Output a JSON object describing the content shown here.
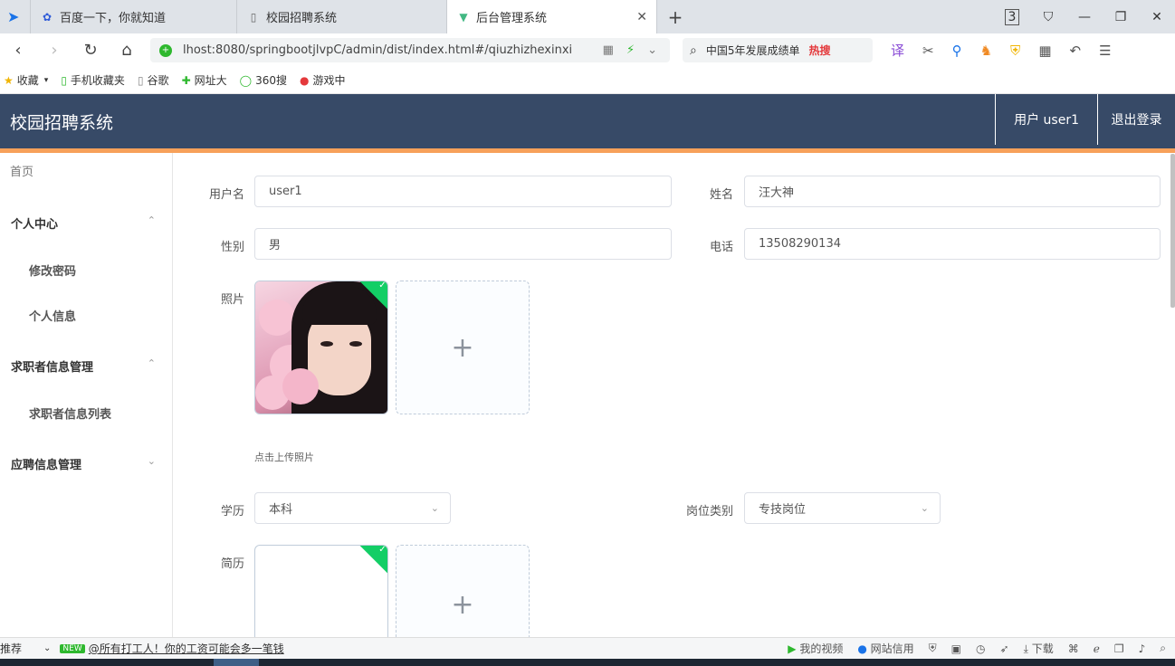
{
  "browser": {
    "tabs": [
      {
        "label": "百度一下，你就知道",
        "icon": "baidu-paw-icon"
      },
      {
        "label": "校园招聘系统",
        "icon": "document-icon"
      },
      {
        "label": "后台管理系统",
        "icon": "vue-icon"
      }
    ],
    "new_tab": "+",
    "tab_count": "3",
    "url": "lhost:8080/springbootjlvpC/admin/dist/index.html#/qiuzhizhexinxi",
    "search_text": "中国5年发展成绩单",
    "search_hot": "热搜",
    "bookmarks": [
      {
        "label": "收藏",
        "icon": "star-icon"
      },
      {
        "label": "手机收藏夹",
        "icon": "phone-icon"
      },
      {
        "label": "谷歌",
        "icon": "document-icon"
      },
      {
        "label": "网址大",
        "icon": "compass-icon"
      },
      {
        "label": "360搜",
        "icon": "circle-icon"
      },
      {
        "label": "游戏中",
        "icon": "game-icon"
      }
    ]
  },
  "header": {
    "title": "校园招聘系统",
    "user": "用户 user1",
    "logout": "退出登录",
    "bg_color": "#374a67",
    "accent_color": "#f7a15a"
  },
  "sidebar": {
    "home": "首页",
    "groups": [
      {
        "label": "个人中心",
        "items": [
          "修改密码",
          "个人信息"
        ]
      },
      {
        "label": "求职者信息管理",
        "items": [
          "求职者信息列表"
        ]
      },
      {
        "label": "应聘信息管理",
        "items": []
      }
    ]
  },
  "form": {
    "username_label": "用户名",
    "username_value": "user1",
    "name_label": "姓名",
    "name_value": "汪大神",
    "gender_label": "性别",
    "gender_value": "男",
    "phone_label": "电话",
    "phone_value": "13508290134",
    "photo_label": "照片",
    "photo_hint": "点击上传照片",
    "education_label": "学历",
    "education_value": "本科",
    "position_type_label": "岗位类别",
    "position_type_value": "专技岗位",
    "resume_label": "简历",
    "plus": "+",
    "check": "✓"
  },
  "statusbar": {
    "left_label": "推荐",
    "new_badge": "NEW",
    "news": "@所有打工人！你的工资可能会多一笔钱",
    "my_video": "我的视频",
    "credit": "网站信用",
    "download": "下载"
  }
}
